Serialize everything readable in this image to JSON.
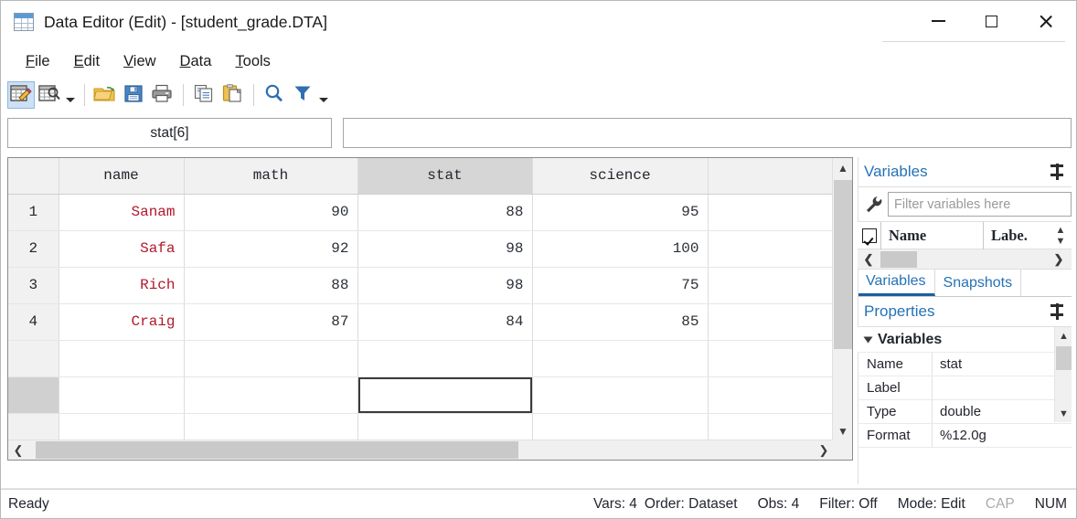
{
  "window": {
    "title": "Data Editor (Edit) - [student_grade.DTA]",
    "icon": "data-grid-icon",
    "controls": {
      "minimize": "minimize-icon",
      "maximize": "maximize-icon",
      "close": "close-icon"
    }
  },
  "menubar": {
    "items": [
      {
        "label": "File",
        "mnemonic": "F"
      },
      {
        "label": "Edit",
        "mnemonic": "E"
      },
      {
        "label": "View",
        "mnemonic": "V"
      },
      {
        "label": "Data",
        "mnemonic": "D"
      },
      {
        "label": "Tools",
        "mnemonic": "T"
      }
    ]
  },
  "toolbar": {
    "buttons": [
      {
        "name": "data-editor-edit-icon",
        "active": true
      },
      {
        "name": "data-editor-browse-icon",
        "active": false
      },
      {
        "name": "browse-dropdown-caret-icon",
        "active": false
      },
      {
        "name": "open-folder-icon",
        "active": false
      },
      {
        "name": "save-icon",
        "active": false
      },
      {
        "name": "print-icon",
        "active": false
      },
      {
        "name": "copy-icon",
        "active": false
      },
      {
        "name": "paste-icon",
        "active": false
      },
      {
        "name": "search-icon",
        "active": false
      },
      {
        "name": "filter-funnel-icon",
        "active": false
      },
      {
        "name": "filter-dropdown-caret-icon",
        "active": false
      }
    ]
  },
  "cell_bar": {
    "reference": "stat[6]",
    "value": "",
    "value_placeholder": ""
  },
  "grid": {
    "columns": [
      "name",
      "math",
      "stat",
      "science",
      ""
    ],
    "selected_column": "stat",
    "selected_cell": {
      "column": "stat",
      "row": 6
    },
    "rows": [
      {
        "num": "1",
        "name": "Sanam",
        "math": "90",
        "stat": "88",
        "science": "95",
        "blank": ""
      },
      {
        "num": "2",
        "name": "Safa",
        "math": "92",
        "stat": "98",
        "science": "100",
        "blank": ""
      },
      {
        "num": "3",
        "name": "Rich",
        "math": "88",
        "stat": "98",
        "science": "75",
        "blank": ""
      },
      {
        "num": "4",
        "name": "Craig",
        "math": "87",
        "stat": "84",
        "science": "85",
        "blank": ""
      },
      {
        "num": "",
        "name": "",
        "math": "",
        "stat": "",
        "science": "",
        "blank": ""
      },
      {
        "num": "",
        "name": "",
        "math": "",
        "stat": "",
        "science": "",
        "blank": ""
      },
      {
        "num": "",
        "name": "",
        "math": "",
        "stat": "",
        "science": "",
        "blank": ""
      }
    ],
    "string_color": "#b2182b",
    "number_color": "#2a2f38",
    "selected_header_color": "#d6d6d6",
    "scrollbars": {
      "vertical_up": "chevron-up-icon",
      "vertical_down": "chevron-down-icon",
      "horizontal_left": "chevron-left-icon",
      "horizontal_right": "chevron-right-icon"
    }
  },
  "variables_panel": {
    "title": "Variables",
    "pin": "pin-icon",
    "filter": {
      "icon": "wrench-icon",
      "value": "",
      "placeholder": "Filter variables here"
    },
    "columns": {
      "checkbox_checked": true,
      "name": "Name",
      "label": "Labe."
    },
    "spinner": "spinner-updown-icon",
    "hscroll": {
      "left": "chevron-left-icon",
      "right": "chevron-right-icon"
    }
  },
  "panel_tabs": {
    "items": [
      {
        "label": "Variables",
        "active": true
      },
      {
        "label": "Snapshots",
        "active": false
      }
    ]
  },
  "properties_panel": {
    "title": "Properties",
    "pin": "pin-icon",
    "group": "Variables",
    "rows": [
      {
        "key": "Name",
        "value": "stat"
      },
      {
        "key": "Label",
        "value": ""
      },
      {
        "key": "Type",
        "value": "double"
      },
      {
        "key": "Format",
        "value": "%12.0g"
      }
    ]
  },
  "statusbar": {
    "ready": "Ready",
    "vars": "Vars: 4",
    "order": "Order: Dataset",
    "obs": "Obs: 4",
    "filter": "Filter: Off",
    "mode": "Mode: Edit",
    "cap": "CAP",
    "num": "NUM"
  },
  "colors": {
    "accent_blue": "#2672b5",
    "string_red": "#b2182b",
    "selection_gray": "#d6d6d6",
    "toolbar_active": "#cde0f5"
  }
}
